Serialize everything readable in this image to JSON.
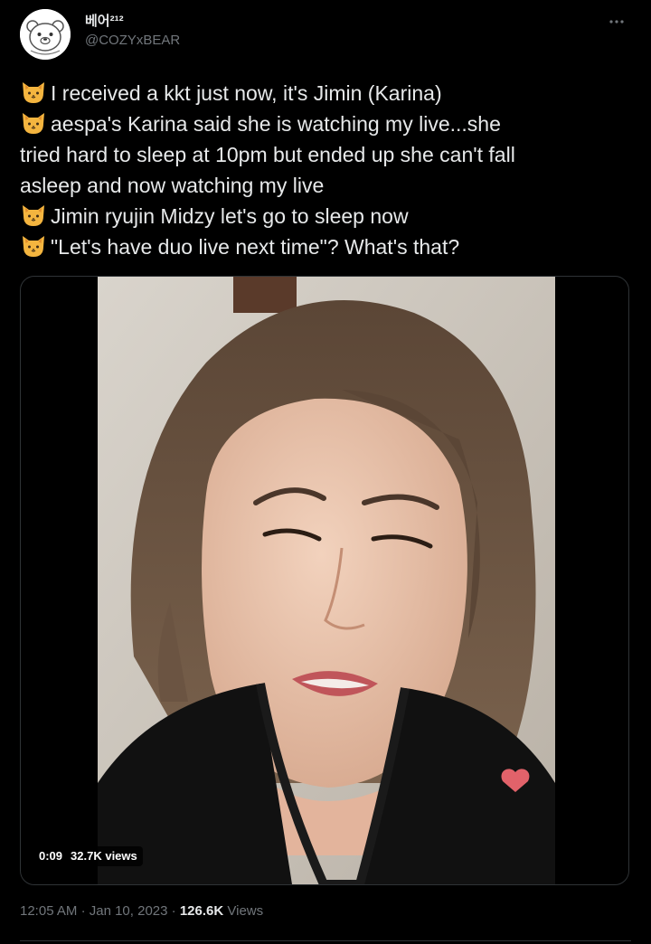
{
  "tweet": {
    "author": {
      "display_name": "베어²¹²",
      "handle": "@COZYxBEAR",
      "avatar_icon": "polar-bear-avatar"
    },
    "more_icon": "more-horizontal-icon",
    "emoji_icon": "cat-face-emoji",
    "lines": [
      "I received a kkt just now, it's Jimin (Karina)",
      "aespa's Karina said she is watching my live...she",
      "tried hard to sleep at 10pm but ended up she can't fall",
      "asleep and now watching my live",
      "Jimin ryujin Midzy let's go to sleep now",
      "\"Let's have duo live next time\"? What's that?"
    ],
    "video": {
      "duration": "0:09",
      "views": "32.7K views",
      "heart_icon": "heart-icon"
    },
    "time": "12:05 AM",
    "separator": "·",
    "date": "Jan 10, 2023",
    "view_count": "126.6K",
    "view_label": "Views"
  },
  "colors": {
    "background": "#000000",
    "text": "#e7e9ea",
    "secondary": "#71767b",
    "border": "#2f3336"
  }
}
